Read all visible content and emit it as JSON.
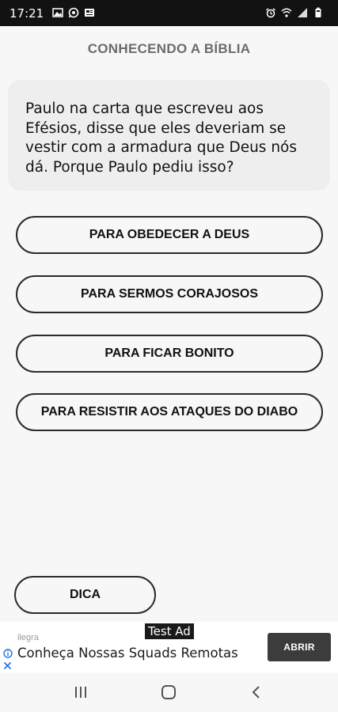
{
  "status_bar": {
    "time": "17:21",
    "left_icons": [
      "image-icon",
      "whatsapp-icon",
      "news-icon"
    ],
    "right_icons": [
      "alarm-icon",
      "wifi-icon",
      "signal-icon",
      "battery-icon"
    ]
  },
  "header": {
    "title": "CONHECENDO A BÍBLIA"
  },
  "question": {
    "text": "Paulo na carta que escreveu aos Efésios, disse que eles deveriam se vestir com a armadura que Deus nós dá. Porque Paulo pediu isso?"
  },
  "options": [
    {
      "label": "PARA OBEDECER A DEUS"
    },
    {
      "label": "PARA SERMOS CORAJOSOS"
    },
    {
      "label": "PARA FICAR BONITO"
    },
    {
      "label": "PARA RESISTIR AOS ATAQUES DO DIABO"
    }
  ],
  "hint": {
    "label": "DICA"
  },
  "ad": {
    "badge": "Test Ad",
    "advertiser": "ilegra",
    "headline": "Conheça Nossas Squads Remotas",
    "cta": "ABRIR",
    "info_icon_color": "#1a73e8"
  },
  "nav": {
    "icons": [
      "recent-apps-icon",
      "home-icon",
      "back-icon"
    ]
  }
}
